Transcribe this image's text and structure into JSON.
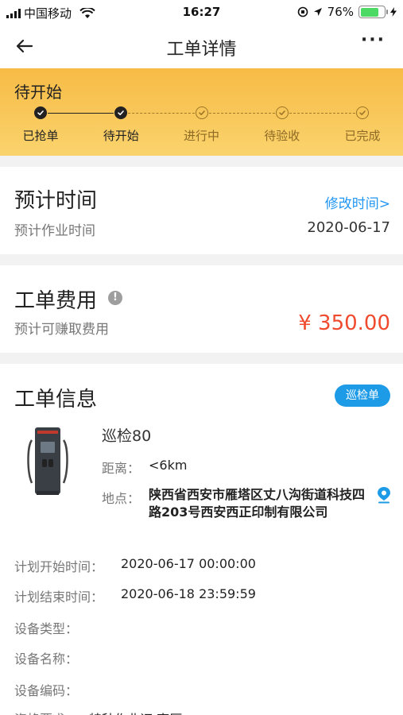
{
  "status_bar": {
    "carrier": "中国移动",
    "time": "16:27",
    "battery": "76%",
    "battery_level": 0.76
  },
  "nav": {
    "title": "工单详情",
    "more": "···"
  },
  "progress": {
    "current_status": "待开始",
    "steps": [
      {
        "label": "已抢单",
        "state": "done"
      },
      {
        "label": "待开始",
        "state": "done"
      },
      {
        "label": "进行中",
        "state": "todo"
      },
      {
        "label": "待验收",
        "state": "todo"
      },
      {
        "label": "已完成",
        "state": "todo"
      }
    ]
  },
  "schedule": {
    "title": "预计时间",
    "edit_link": "修改时间>",
    "label": "预计作业时间",
    "date": "2020-06-17"
  },
  "fee": {
    "title": "工单费用",
    "label": "预计可赚取费用",
    "amount": "¥ 350.00",
    "info_icon": "!"
  },
  "info": {
    "title": "工单信息",
    "badge": "巡检单",
    "device_name": "巡检80",
    "distance_label": "距离：",
    "distance": "<6km",
    "location_label": "地点：",
    "location": "陕西省西安市雁塔区丈八沟街道科技四路203号西安西正印制有限公司",
    "plan_start_label": "计划开始时间：",
    "plan_start": "2020-06-17 00:00:00",
    "plan_end_label": "计划结束时间：",
    "plan_end": "2020-06-18 23:59:59",
    "device_type_label": "设备类型：",
    "device_name_label": "设备名称：",
    "device_code_label": "设备编码：",
    "requirement_label": "资格要求：",
    "requirement": "特种作业证 高压"
  },
  "colors": {
    "accent": "#2196f3",
    "price": "#f04a2e",
    "banner_top": "#f7bb45",
    "banner_bottom": "#fad36d",
    "badge": "#1e9be6"
  }
}
